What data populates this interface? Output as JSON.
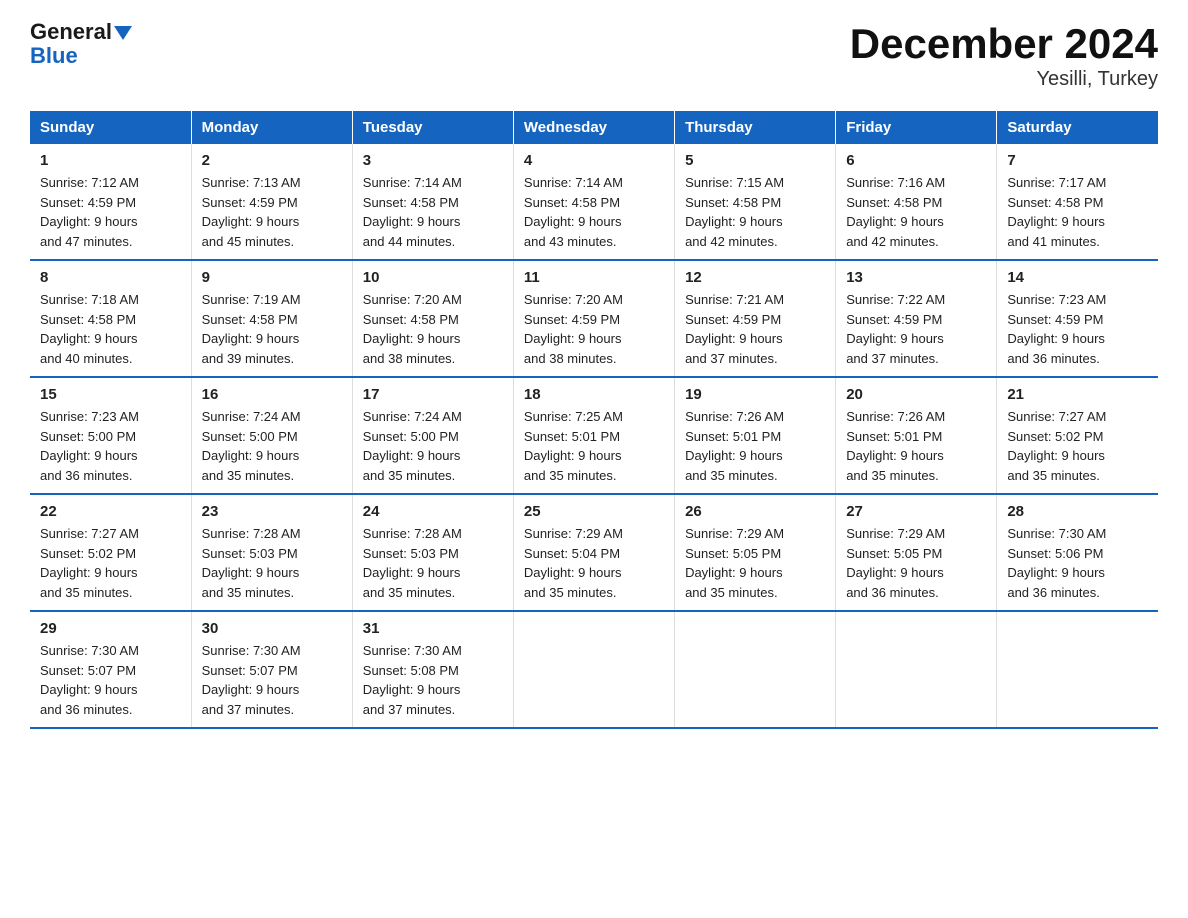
{
  "logo": {
    "line1": "General",
    "line2": "Blue"
  },
  "title": "December 2024",
  "subtitle": "Yesilli, Turkey",
  "days_of_week": [
    "Sunday",
    "Monday",
    "Tuesday",
    "Wednesday",
    "Thursday",
    "Friday",
    "Saturday"
  ],
  "weeks": [
    [
      {
        "day": "1",
        "info": "Sunrise: 7:12 AM\nSunset: 4:59 PM\nDaylight: 9 hours\nand 47 minutes."
      },
      {
        "day": "2",
        "info": "Sunrise: 7:13 AM\nSunset: 4:59 PM\nDaylight: 9 hours\nand 45 minutes."
      },
      {
        "day": "3",
        "info": "Sunrise: 7:14 AM\nSunset: 4:58 PM\nDaylight: 9 hours\nand 44 minutes."
      },
      {
        "day": "4",
        "info": "Sunrise: 7:14 AM\nSunset: 4:58 PM\nDaylight: 9 hours\nand 43 minutes."
      },
      {
        "day": "5",
        "info": "Sunrise: 7:15 AM\nSunset: 4:58 PM\nDaylight: 9 hours\nand 42 minutes."
      },
      {
        "day": "6",
        "info": "Sunrise: 7:16 AM\nSunset: 4:58 PM\nDaylight: 9 hours\nand 42 minutes."
      },
      {
        "day": "7",
        "info": "Sunrise: 7:17 AM\nSunset: 4:58 PM\nDaylight: 9 hours\nand 41 minutes."
      }
    ],
    [
      {
        "day": "8",
        "info": "Sunrise: 7:18 AM\nSunset: 4:58 PM\nDaylight: 9 hours\nand 40 minutes."
      },
      {
        "day": "9",
        "info": "Sunrise: 7:19 AM\nSunset: 4:58 PM\nDaylight: 9 hours\nand 39 minutes."
      },
      {
        "day": "10",
        "info": "Sunrise: 7:20 AM\nSunset: 4:58 PM\nDaylight: 9 hours\nand 38 minutes."
      },
      {
        "day": "11",
        "info": "Sunrise: 7:20 AM\nSunset: 4:59 PM\nDaylight: 9 hours\nand 38 minutes."
      },
      {
        "day": "12",
        "info": "Sunrise: 7:21 AM\nSunset: 4:59 PM\nDaylight: 9 hours\nand 37 minutes."
      },
      {
        "day": "13",
        "info": "Sunrise: 7:22 AM\nSunset: 4:59 PM\nDaylight: 9 hours\nand 37 minutes."
      },
      {
        "day": "14",
        "info": "Sunrise: 7:23 AM\nSunset: 4:59 PM\nDaylight: 9 hours\nand 36 minutes."
      }
    ],
    [
      {
        "day": "15",
        "info": "Sunrise: 7:23 AM\nSunset: 5:00 PM\nDaylight: 9 hours\nand 36 minutes."
      },
      {
        "day": "16",
        "info": "Sunrise: 7:24 AM\nSunset: 5:00 PM\nDaylight: 9 hours\nand 35 minutes."
      },
      {
        "day": "17",
        "info": "Sunrise: 7:24 AM\nSunset: 5:00 PM\nDaylight: 9 hours\nand 35 minutes."
      },
      {
        "day": "18",
        "info": "Sunrise: 7:25 AM\nSunset: 5:01 PM\nDaylight: 9 hours\nand 35 minutes."
      },
      {
        "day": "19",
        "info": "Sunrise: 7:26 AM\nSunset: 5:01 PM\nDaylight: 9 hours\nand 35 minutes."
      },
      {
        "day": "20",
        "info": "Sunrise: 7:26 AM\nSunset: 5:01 PM\nDaylight: 9 hours\nand 35 minutes."
      },
      {
        "day": "21",
        "info": "Sunrise: 7:27 AM\nSunset: 5:02 PM\nDaylight: 9 hours\nand 35 minutes."
      }
    ],
    [
      {
        "day": "22",
        "info": "Sunrise: 7:27 AM\nSunset: 5:02 PM\nDaylight: 9 hours\nand 35 minutes."
      },
      {
        "day": "23",
        "info": "Sunrise: 7:28 AM\nSunset: 5:03 PM\nDaylight: 9 hours\nand 35 minutes."
      },
      {
        "day": "24",
        "info": "Sunrise: 7:28 AM\nSunset: 5:03 PM\nDaylight: 9 hours\nand 35 minutes."
      },
      {
        "day": "25",
        "info": "Sunrise: 7:29 AM\nSunset: 5:04 PM\nDaylight: 9 hours\nand 35 minutes."
      },
      {
        "day": "26",
        "info": "Sunrise: 7:29 AM\nSunset: 5:05 PM\nDaylight: 9 hours\nand 35 minutes."
      },
      {
        "day": "27",
        "info": "Sunrise: 7:29 AM\nSunset: 5:05 PM\nDaylight: 9 hours\nand 36 minutes."
      },
      {
        "day": "28",
        "info": "Sunrise: 7:30 AM\nSunset: 5:06 PM\nDaylight: 9 hours\nand 36 minutes."
      }
    ],
    [
      {
        "day": "29",
        "info": "Sunrise: 7:30 AM\nSunset: 5:07 PM\nDaylight: 9 hours\nand 36 minutes."
      },
      {
        "day": "30",
        "info": "Sunrise: 7:30 AM\nSunset: 5:07 PM\nDaylight: 9 hours\nand 37 minutes."
      },
      {
        "day": "31",
        "info": "Sunrise: 7:30 AM\nSunset: 5:08 PM\nDaylight: 9 hours\nand 37 minutes."
      },
      {
        "day": "",
        "info": ""
      },
      {
        "day": "",
        "info": ""
      },
      {
        "day": "",
        "info": ""
      },
      {
        "day": "",
        "info": ""
      }
    ]
  ]
}
